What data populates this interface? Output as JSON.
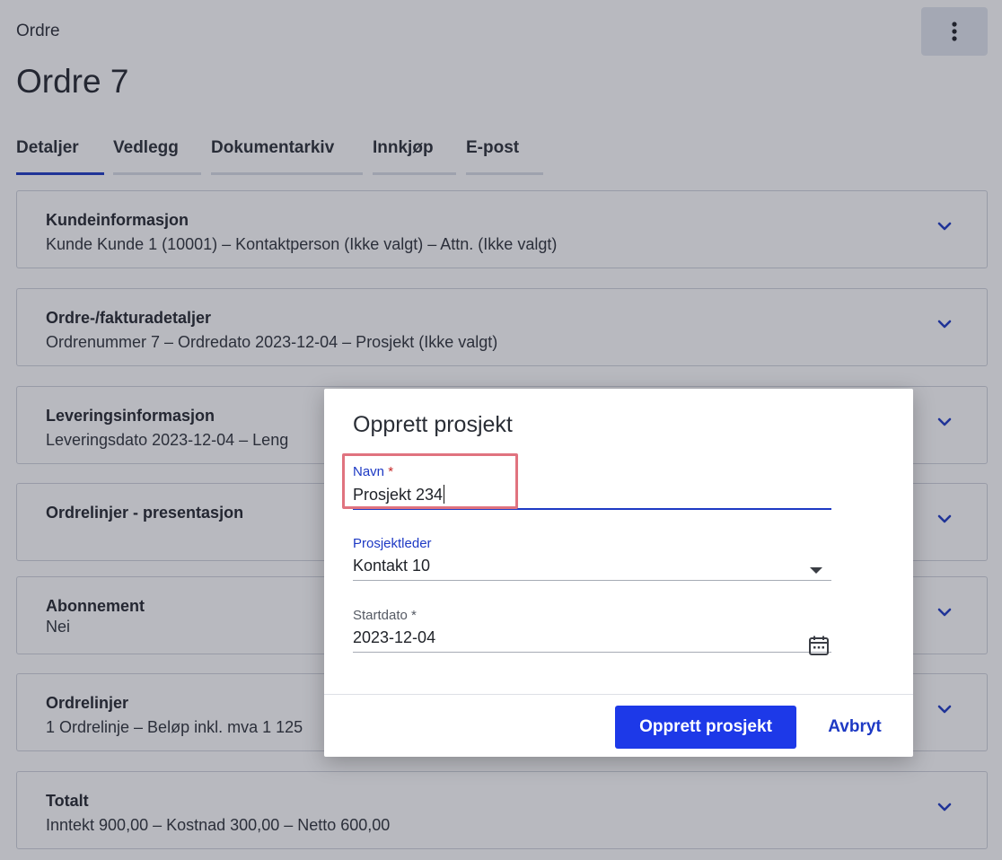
{
  "header": {
    "breadcrumb": "Ordre",
    "title": "Ordre 7"
  },
  "tabs": [
    {
      "label": "Detaljer",
      "active": true
    },
    {
      "label": "Vedlegg",
      "active": false
    },
    {
      "label": "Dokumentarkiv",
      "active": false
    },
    {
      "label": "Innkjøp",
      "active": false
    },
    {
      "label": "E-post",
      "active": false
    }
  ],
  "cards": [
    {
      "title": "Kundeinformasjon",
      "summary": "Kunde Kunde 1 (10001)  –  Kontaktperson (Ikke valgt)  –  Attn. (Ikke valgt)"
    },
    {
      "title": "Ordre-/fakturadetaljer",
      "summary": "Ordrenummer 7  –  Ordredato 2023-12-04  –  Prosjekt (Ikke valgt)"
    },
    {
      "title": "Leveringsinformasjon",
      "summary": "Leveringsdato 2023-12-04  –  Leng"
    },
    {
      "title": "Ordrelinjer - presentasjon",
      "summary": ""
    },
    {
      "title": "Abonnement",
      "summary": "Nei"
    },
    {
      "title": "Ordrelinjer",
      "summary": "1 Ordrelinje  –  Beløp inkl. mva 1 125"
    },
    {
      "title": "Totalt",
      "summary": "Inntekt 900,00  –  Kostnad 300,00  –  Netto 600,00"
    }
  ],
  "dialog": {
    "title": "Opprett prosjekt",
    "name_label": "Navn",
    "name_required": "*",
    "name_value": "Prosjekt 234",
    "manager_label": "Prosjektleder",
    "manager_value": "Kontakt 10",
    "start_label": "Startdato",
    "start_required": "*",
    "start_value": "2023-12-04",
    "create_button": "Opprett prosjekt",
    "cancel_button": "Avbryt"
  },
  "colors": {
    "accent": "#1d39c4",
    "primary_button": "#1d39e8",
    "highlight_box": "#e0737f"
  },
  "icons": {
    "menu": "more-vertical-icon",
    "expand": "chevron-down-icon",
    "dropdown": "triangle-down-icon",
    "date": "calendar-icon"
  }
}
